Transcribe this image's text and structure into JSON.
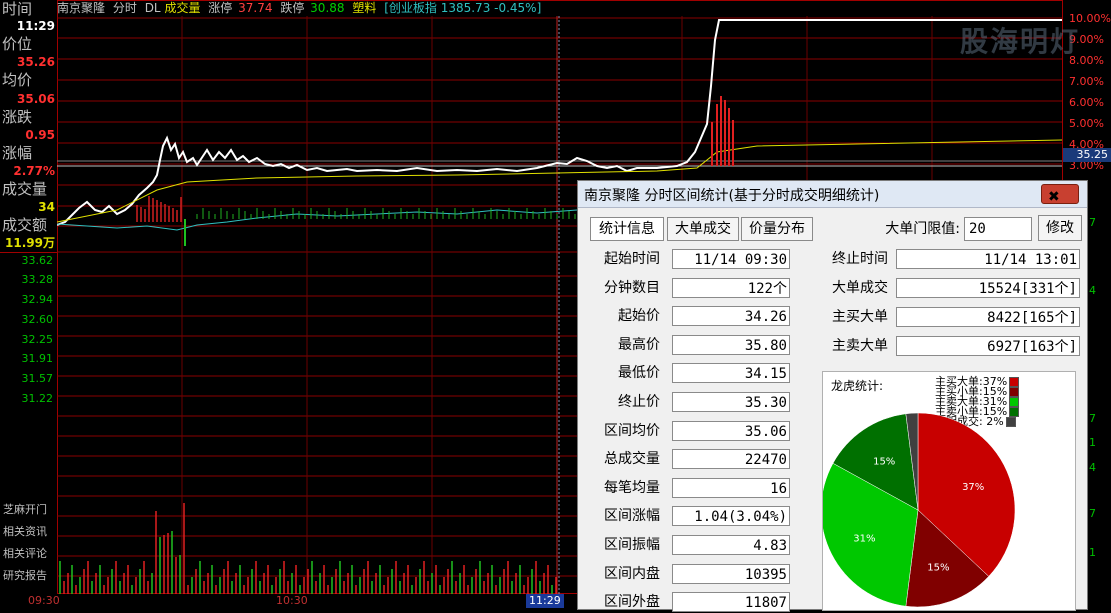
{
  "quote": {
    "name": "南京聚隆",
    "mode": "分时",
    "dl": "DL",
    "vol_label": "成交量",
    "limit_up_label": "涨停",
    "limit_up": "37.74",
    "limit_down_label": "跌停",
    "limit_down": "30.88",
    "sector": "塑料",
    "index_text": "[创业板指 1385.73 -0.45%]",
    "current_price_tag": "35.25"
  },
  "left_panel": {
    "time_label": "时间",
    "time_value": "11:29",
    "price_label": "价位",
    "price_value": "35.26",
    "avg_label": "均价",
    "avg_value": "35.06",
    "change_label": "涨跌",
    "change_value": "0.95",
    "pct_label": "涨幅",
    "pct_value": "2.77%",
    "vol_label": "成交量",
    "vol_value": "34",
    "amount_label": "成交额",
    "amount_value": "11.99万",
    "price_ticks": [
      "33.62",
      "33.28",
      "32.94",
      "32.60",
      "32.25",
      "31.91",
      "31.57",
      "31.22"
    ],
    "links": [
      "芝麻开门",
      "相关资讯",
      "相关评论",
      "研究报告"
    ]
  },
  "right_axis": {
    "pct_ticks": [
      "10.00%",
      "9.00%",
      "8.00%",
      "7.00%",
      "6.00%",
      "5.00%",
      "4.00%",
      "3.00%"
    ],
    "partial_ticks": [
      "7",
      "4",
      "7",
      "1",
      "4",
      "7",
      "1"
    ]
  },
  "time_axis": [
    "09:30",
    "10:30",
    "11:29"
  ],
  "watermark": "股海明灯",
  "dialog": {
    "title": "南京聚隆 分时区间统计(基于分时成交明细统计)",
    "close": "✖",
    "tabs": [
      "统计信息",
      "大单成交",
      "价量分布"
    ],
    "threshold_label": "大单门限值:",
    "threshold_value": "20",
    "modify_label": "修改",
    "left_fields": [
      {
        "label": "起始时间",
        "value": "11/14 09:30"
      },
      {
        "label": "分钟数目",
        "value": "122个"
      },
      {
        "label": "起始价",
        "value": "34.26"
      },
      {
        "label": "最高价",
        "value": "35.80"
      },
      {
        "label": "最低价",
        "value": "34.15"
      },
      {
        "label": "终止价",
        "value": "35.30"
      },
      {
        "label": "区间均价",
        "value": "35.06"
      },
      {
        "label": "总成交量",
        "value": "22470"
      },
      {
        "label": "每笔均量",
        "value": "16"
      },
      {
        "label": "区间涨幅",
        "value": "1.04(3.04%)"
      },
      {
        "label": "区间振幅",
        "value": "4.83"
      },
      {
        "label": "区间内盘",
        "value": "10395"
      },
      {
        "label": "区间外盘",
        "value": "11807"
      }
    ],
    "right_fields": [
      {
        "label": "终止时间",
        "value": "11/14 13:01"
      },
      {
        "label": "大单成交",
        "value": "15524[331个]"
      },
      {
        "label": "主买大单",
        "value": "8422[165个]"
      },
      {
        "label": "主卖大单",
        "value": "6927[163个]"
      }
    ],
    "pie_title": "龙虎统计:",
    "legend": [
      {
        "text": "主买大单:37%",
        "color": "#c80000"
      },
      {
        "text": "主买小单:15%",
        "color": "#800000"
      },
      {
        "text": "主卖大单:31%",
        "color": "#00c800"
      },
      {
        "text": "主卖小单:15%",
        "color": "#007000"
      },
      {
        "text": "不明成交: 2%",
        "color": "#404040"
      }
    ]
  },
  "chart_data": {
    "type": "pie",
    "title": "龙虎统计:",
    "labels": [
      "主买大单",
      "主买小单",
      "主卖大单",
      "主卖小单",
      "不明成交"
    ],
    "values": [
      37,
      15,
      31,
      15,
      2
    ],
    "slice_labels": [
      "37%",
      "15%",
      "31%",
      "15%",
      ""
    ],
    "colors": [
      "#c80000",
      "#800000",
      "#00c800",
      "#007000",
      "#404040"
    ]
  }
}
